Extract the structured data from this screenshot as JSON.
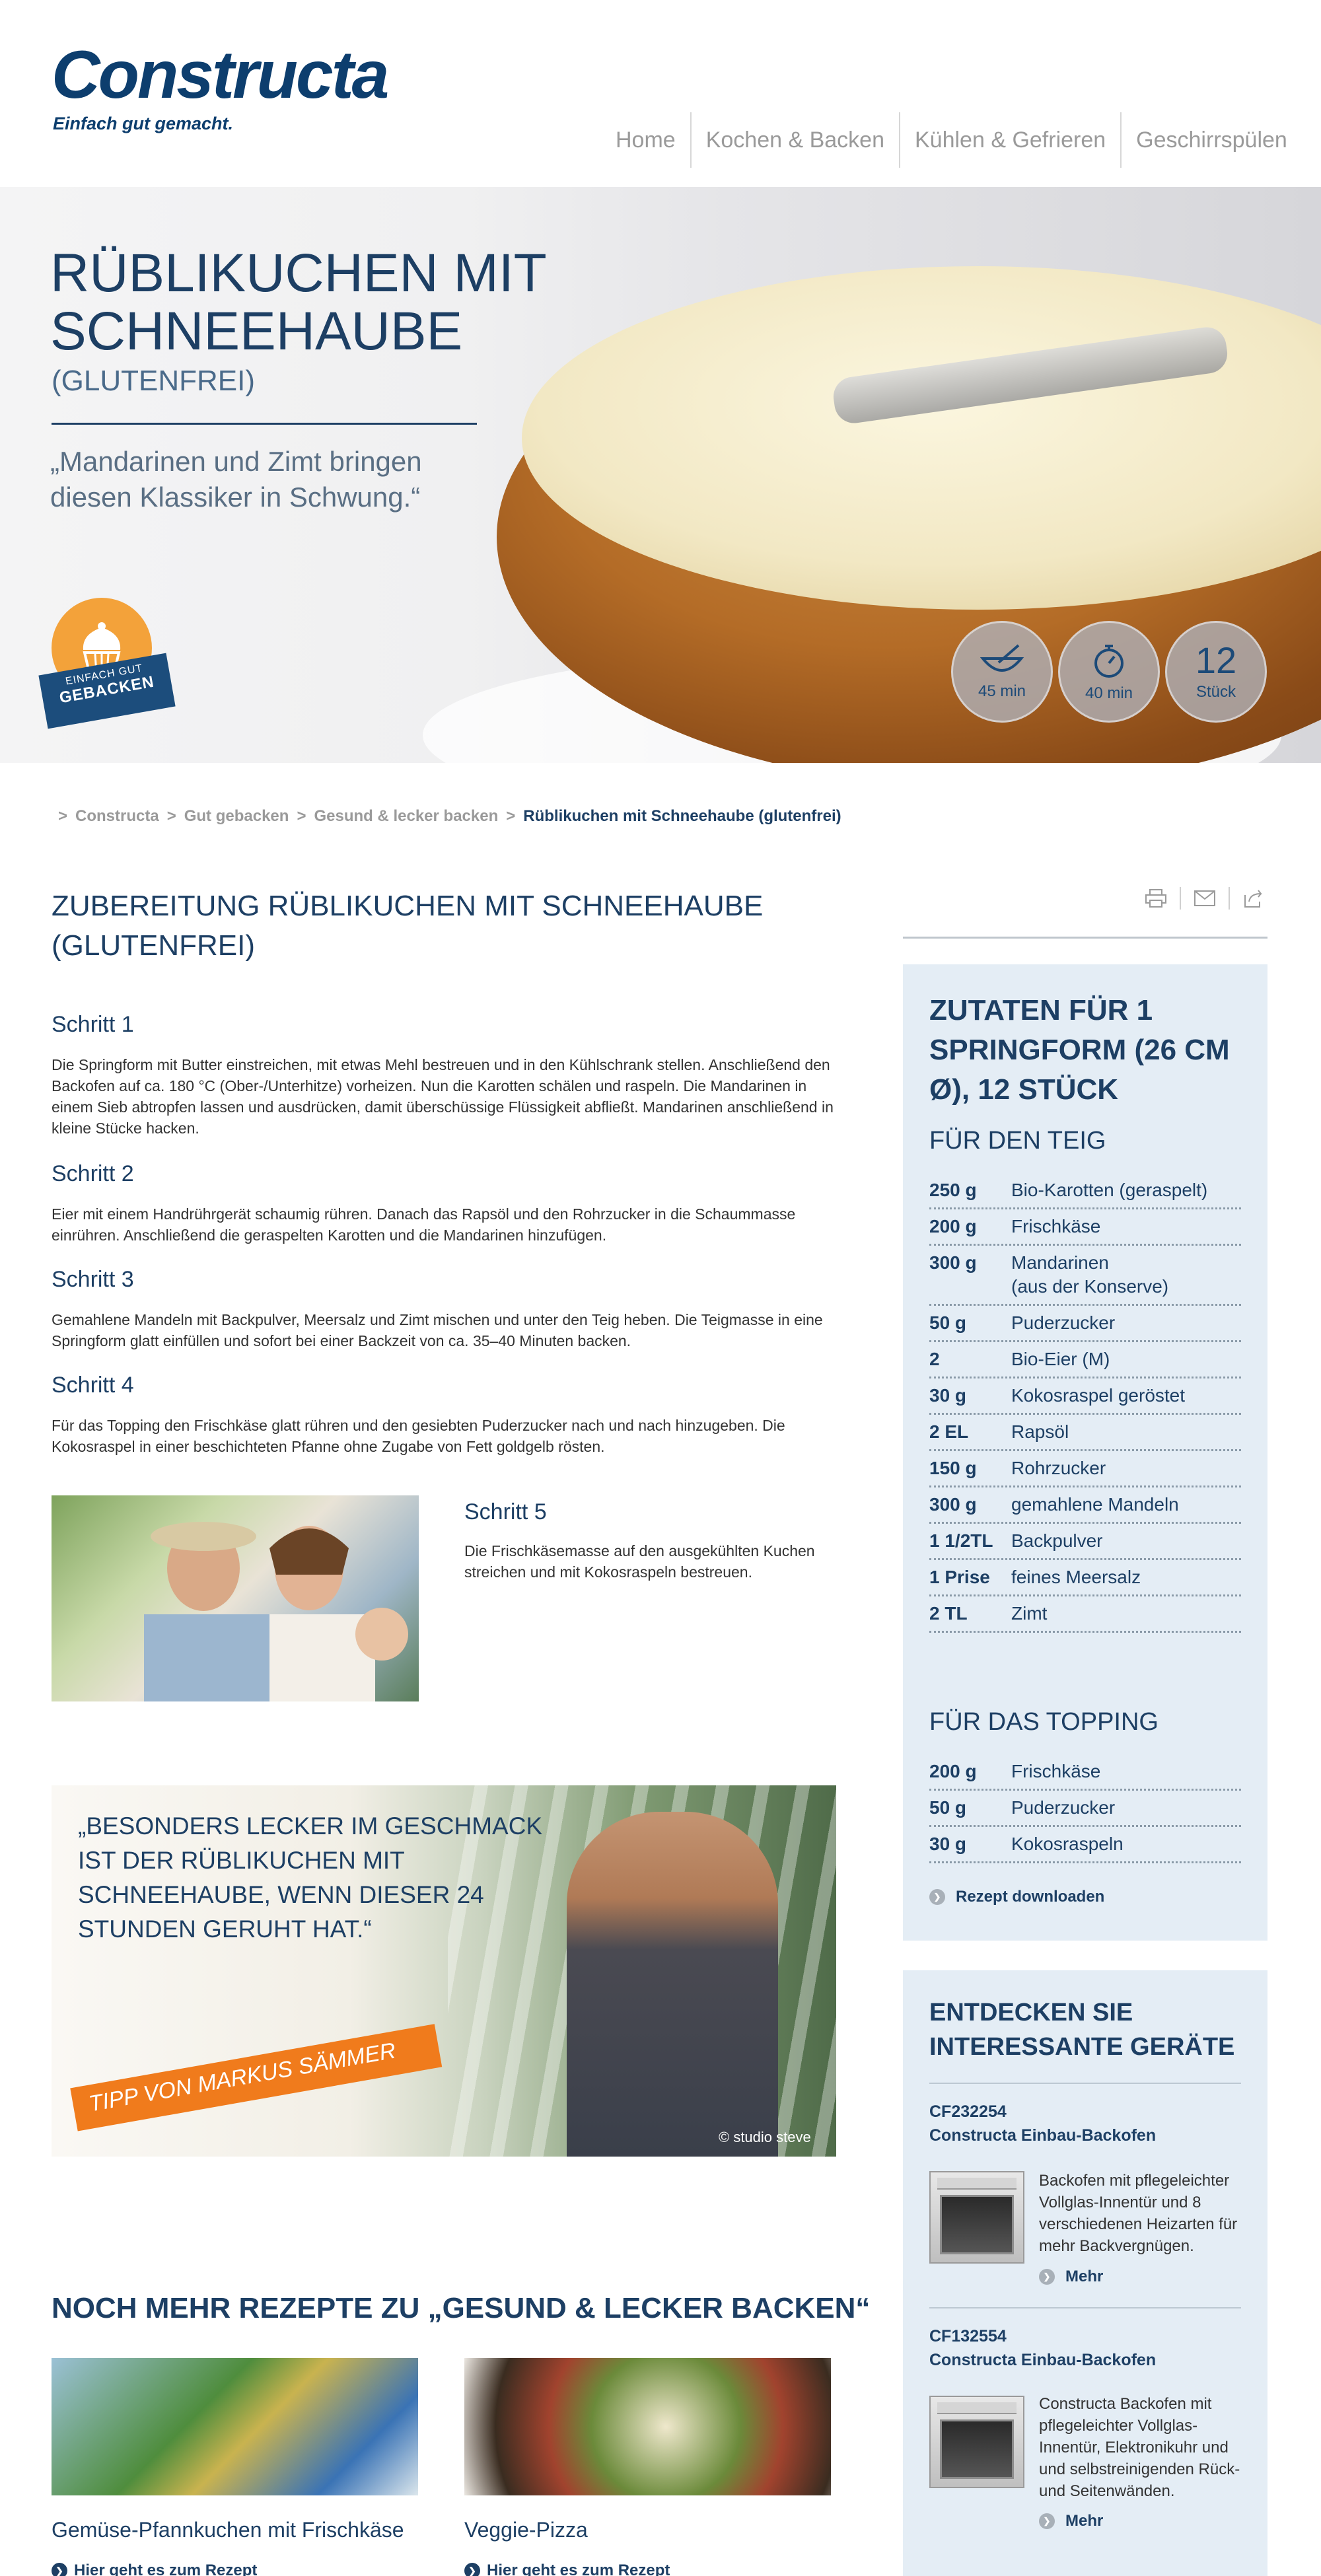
{
  "header": {
    "logo_text": "Constructa",
    "tagline": "Einfach gut gemacht.",
    "nav": [
      "Home",
      "Kochen & Backen",
      "Kühlen & Gefrieren",
      "Geschirrspülen"
    ]
  },
  "hero": {
    "title": "RÜBLIKUCHEN MIT SCHNEEHAUBE",
    "subtitle": "(GLUTENFREI)",
    "quote": "„Mandarinen und Zimt bringen diesen Klassiker in Schwung.“",
    "badge": {
      "line1": "EINFACH GUT",
      "line2": "GEBACKEN"
    },
    "info": [
      {
        "icon": "bowl-whisk-icon",
        "label": "45 min"
      },
      {
        "icon": "stopwatch-icon",
        "label": "40 min"
      },
      {
        "value": "12",
        "label": "Stück"
      }
    ]
  },
  "breadcrumb": {
    "items": [
      "Constructa",
      "Gut gebacken",
      "Gesund & lecker backen"
    ],
    "current": "Rüblikuchen mit Schneehaube (glutenfrei)",
    "separator": ">"
  },
  "preparation": {
    "title": "ZUBEREITUNG RÜBLIKUCHEN MIT SCHNEEHAUBE (GLUTENFREI)",
    "steps": [
      {
        "title": "Schritt 1",
        "text": "Die Springform mit Butter einstreichen, mit etwas Mehl bestreuen und in den Kühlschrank stellen. Anschließend den Backofen auf ca. 180 °C (Ober-/Unterhitze) vorheizen. Nun die Karotten schälen und raspeln. Die Mandarinen in einem Sieb abtropfen lassen und ausdrücken, damit überschüssige Flüssigkeit abfließt. Mandarinen anschließend in kleine Stücke hacken."
      },
      {
        "title": "Schritt 2",
        "text": "Eier mit einem Handrührgerät schaumig rühren. Danach das Rapsöl und den Rohrzucker in die Schaummasse einrühren. Anschließend die geraspelten Karotten und die Mandarinen hinzufügen."
      },
      {
        "title": "Schritt 3",
        "text": "Gemahlene Mandeln mit Backpulver, Meersalz und Zimt mischen und unter den Teig heben. Die Teigmasse in eine Springform glatt einfüllen und sofort bei einer Backzeit von ca. 35–40 Minuten backen."
      },
      {
        "title": "Schritt 4",
        "text": "Für das Topping den Frischkäse glatt rühren und den gesiebten Puderzucker nach und nach hinzugeben. Die Kokosraspel in einer beschichteten Pfanne ohne Zugabe von Fett goldgelb rösten."
      },
      {
        "title": "Schritt 5",
        "text": "Die Frischkäsemasse auf den ausgekühlten Kuchen streichen und mit Kokosraspeln bestreuen."
      }
    ]
  },
  "tip": {
    "quote": "„BESONDERS LECKER IM GESCHMACK IST DER RÜBLIKUCHEN MIT SCHNEEHAUBE, WENN DIESER 24 STUNDEN GERUHT HAT.“",
    "ribbon": "TIPP VON MARKUS SÄMMER",
    "credit": "© studio steve"
  },
  "more_recipes": {
    "title": "NOCH MEHR REZEPTE ZU „GESUND & LECKER BACKEN“",
    "items": [
      {
        "title": "Gemüse-Pfannkuchen mit Frischkäse",
        "link": "Hier geht es zum Rezept"
      },
      {
        "title": "Veggie-Pizza",
        "link": "Hier geht es zum Rezept"
      }
    ]
  },
  "ingredients": {
    "title": "ZUTATEN FÜR 1 SPRINGFORM (26 CM Ø), 12 STÜCK",
    "dough_title": "FÜR DEN TEIG",
    "dough": [
      {
        "qty": "250 g",
        "name": "Bio-Karotten (geraspelt)"
      },
      {
        "qty": "200 g",
        "name": "Frischkäse"
      },
      {
        "qty": "300 g",
        "name": "Mandarinen\n(aus der Konserve)"
      },
      {
        "qty": "50 g",
        "name": "Puderzucker"
      },
      {
        "qty": "2",
        "name": "Bio-Eier (M)"
      },
      {
        "qty": "30 g",
        "name": "Kokosraspel geröstet"
      },
      {
        "qty": "2 EL",
        "name": "Rapsöl"
      },
      {
        "qty": "150 g",
        "name": "Rohrzucker"
      },
      {
        "qty": "300 g",
        "name": "gemahlene Mandeln"
      },
      {
        "qty": "1 1/2TL",
        "name": "Backpulver"
      },
      {
        "qty": "1 Prise",
        "name": "feines Meersalz"
      },
      {
        "qty": "2 TL",
        "name": "Zimt"
      }
    ],
    "topping_title": "FÜR DAS TOPPING",
    "topping": [
      {
        "qty": "200 g",
        "name": "Frischkäse"
      },
      {
        "qty": "50 g",
        "name": "Puderzucker"
      },
      {
        "qty": "30 g",
        "name": "Kokosraspeln"
      }
    ],
    "download": "Rezept downloaden"
  },
  "devices": {
    "title": "ENTDECKEN SIE INTERESSANTE GERÄTE",
    "items": [
      {
        "code": "CF232254",
        "name": "Constructa Einbau-Backofen",
        "desc": "Backofen mit pflegeleichter Vollglas-Innentür und 8 verschiedenen Heizarten für mehr Backvergnügen.",
        "more": "Mehr"
      },
      {
        "code": "CF132554",
        "name": "Constructa Einbau-Backofen",
        "desc": "Constructa Backofen mit pflegeleichter Vollglas-Innentür, Elektronikuhr und und selbstreinigenden Rück- und Seitenwänden.",
        "more": "Mehr"
      }
    ]
  },
  "share_tools": [
    "print-icon",
    "mail-icon",
    "share-icon"
  ],
  "colors": {
    "brand_blue": "#1d3f64",
    "accent_orange": "#f07b1c",
    "sidebar_bg": "#e4edf5"
  }
}
